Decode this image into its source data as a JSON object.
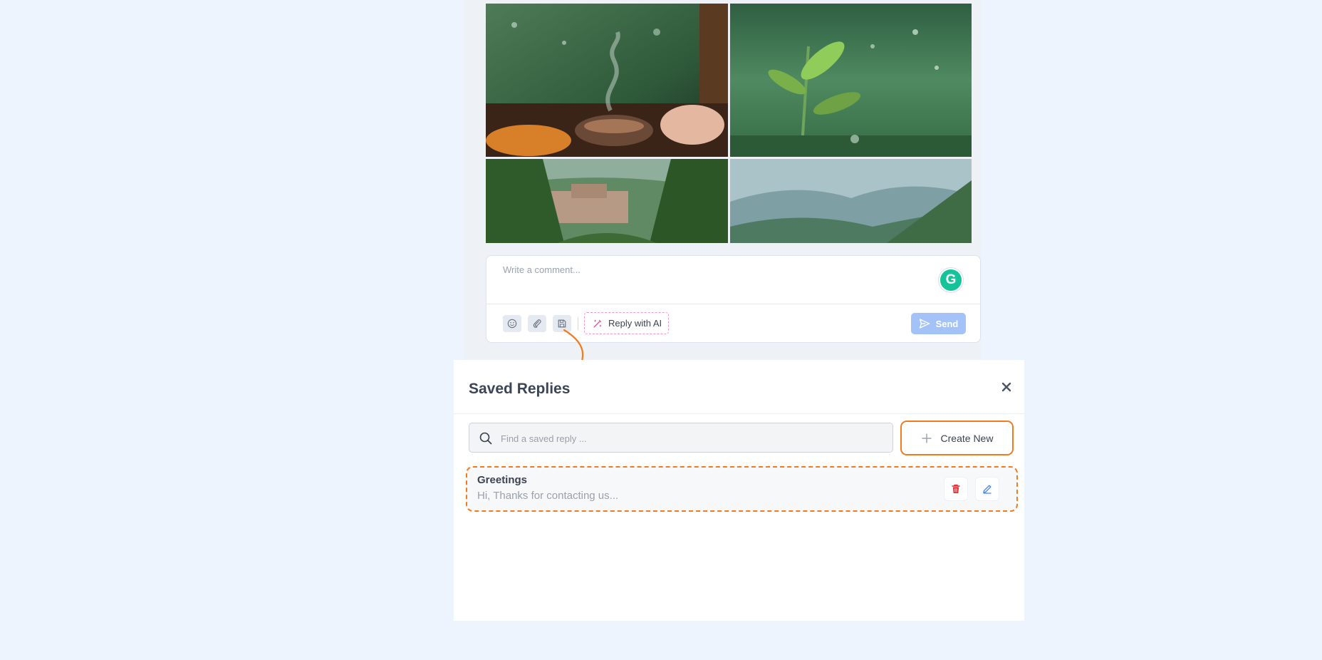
{
  "gallery": {
    "photos": [
      "tea-cup-rain-photo",
      "tea-leaves-rain-photo",
      "hill-town-rain-photo",
      "misty-hills-photo"
    ]
  },
  "comment": {
    "placeholder": "Write a comment...",
    "grammarly_letter": "G",
    "reply_ai_label": "Reply with AI",
    "send_label": "Send"
  },
  "saved_replies": {
    "title": "Saved Replies",
    "close_symbol": "×",
    "search_placeholder": "Find a saved reply ...",
    "create_label": "Create New",
    "items": [
      {
        "title": "Greetings",
        "preview": "Hi, Thanks for contacting us..."
      }
    ]
  },
  "colors": {
    "accent_orange": "#f47a20",
    "send_blue": "#a3c3f8",
    "ai_pink": "#f29ac4",
    "delete_red": "#e0242e",
    "edit_blue": "#3b82f6",
    "background": "#edf4fe"
  }
}
